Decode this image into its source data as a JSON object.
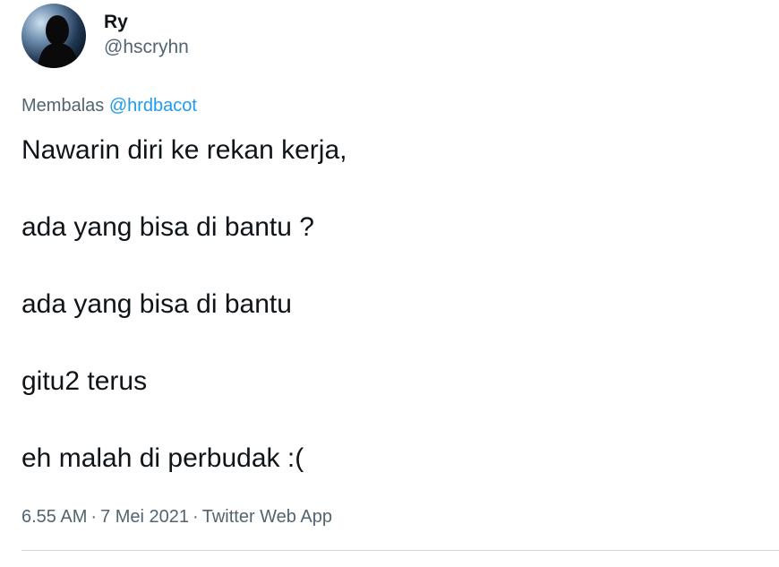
{
  "author": {
    "display_name": "Ry",
    "handle": "@hscryhn"
  },
  "reply": {
    "prefix": "Membalas",
    "mention": "@hrdbacot"
  },
  "body_lines": [
    "Nawarin diri ke rekan kerja,",
    "ada yang bisa di bantu ?",
    "ada yang bisa di bantu",
    "gitu2 terus",
    "eh malah di perbudak :("
  ],
  "meta": {
    "time": "6.55 AM",
    "separator": "·",
    "date": "7 Mei 2021",
    "source": "Twitter Web App"
  },
  "colors": {
    "text": "#0f1419",
    "secondary": "#536471",
    "accent": "#1d9bf0"
  },
  "icons": {
    "avatar": "user-avatar-silhouette"
  }
}
